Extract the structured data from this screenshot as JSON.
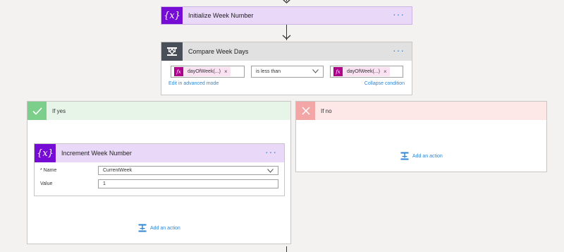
{
  "init_step": {
    "title": "Initialize Week Number",
    "icon": "{x}"
  },
  "condition_step": {
    "title": "Compare Week Days",
    "left_token": "dayOfWeek(...)",
    "operator": "is less than",
    "right_token": "dayOfWeek(...)",
    "token_icon": "fx",
    "token_remove": "×",
    "edit_advanced": "Edit in advanced mode",
    "collapse": "Collapse condition"
  },
  "yes_branch": {
    "label": "If yes",
    "increment_step": {
      "title": "Increment Week Number",
      "icon": "{x}",
      "name_label": "* Name",
      "name_value": "CurrentWeek",
      "value_label": "Value",
      "value_value": "1"
    },
    "add_action": "Add an action"
  },
  "no_branch": {
    "label": "If no",
    "add_action": "Add an action"
  },
  "more_options": "···",
  "colors": {
    "variable_purple": "#770bd6",
    "variable_header_bg": "#e9d8f7",
    "condition_dark": "#484f58",
    "condition_header_bg": "#e1e1e1",
    "yes_green": "#7ccf8b",
    "yes_header_bg": "#e7f5e9",
    "no_red": "#f3a6a6",
    "no_header_bg": "#fde7e7",
    "link_blue": "#2f86d5",
    "fx_magenta": "#ad008c"
  }
}
